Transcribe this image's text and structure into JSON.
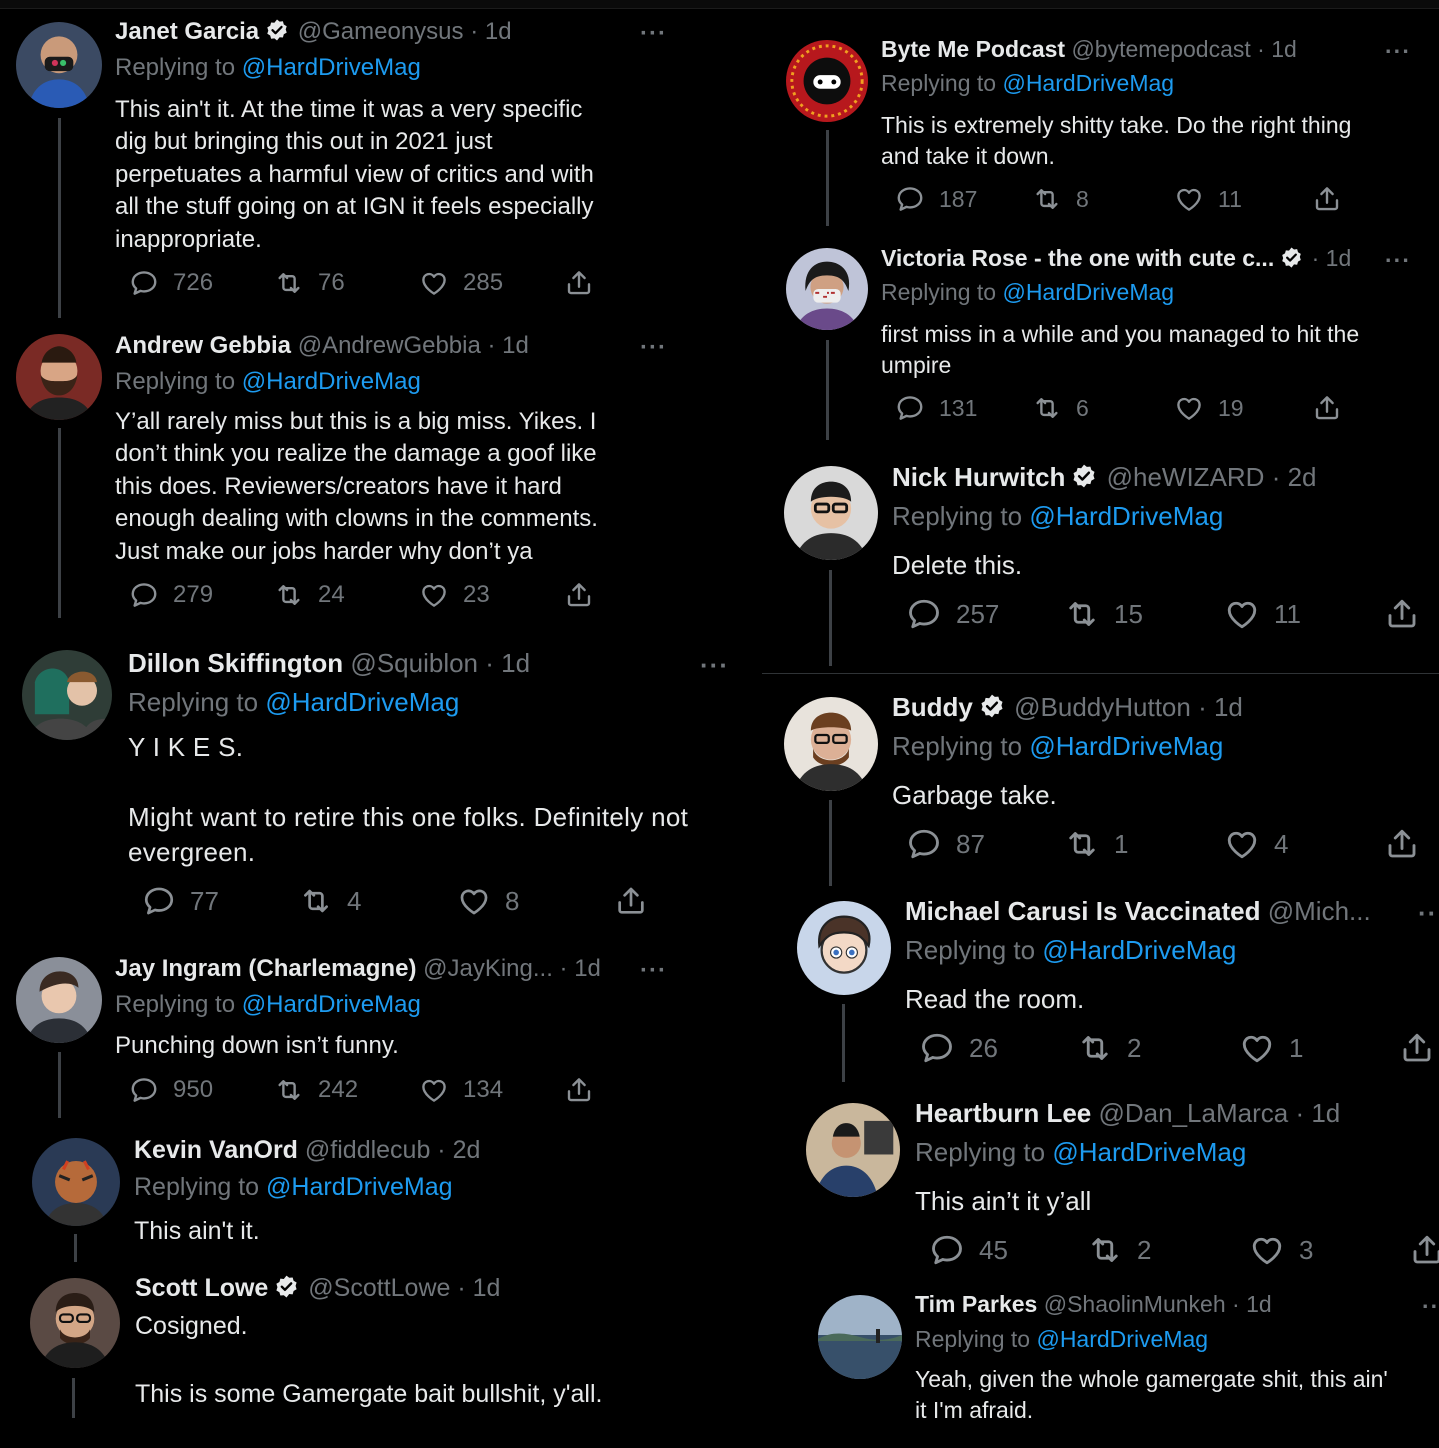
{
  "mention": "@HardDriveMag",
  "replying_prefix": "Replying to ",
  "tweets": [
    {
      "name": "Janet Garcia",
      "handle": "@Gameonysus",
      "time": "1d",
      "text": "This ain't it. At the time it was a very specific\ndig but bringing this out in 2021 just\nperpetuates a harmful view of critics and with\nall the stuff going on at IGN it feels especially\ninappropriate.",
      "replies": "726",
      "retweets": "76",
      "likes": "285",
      "verified": true
    },
    {
      "name": "Andrew Gebbia",
      "handle": "@AndrewGebbia",
      "time": "1d",
      "text": "Y’all rarely miss but this is a big miss. Yikes. I\ndon’t think you realize the damage a goof like\nthis does. Reviewers/creators have it hard\nenough dealing with clowns in the comments.\nJust make our jobs harder why don’t ya",
      "replies": "279",
      "retweets": "24",
      "likes": "23",
      "verified": false
    },
    {
      "name": "Dillon Skiffington",
      "handle": "@Squiblon",
      "time": "1d",
      "text": "Y I K E S.\n\nMight want to retire this one folks. Definitely not\nevergreen.",
      "replies": "77",
      "retweets": "4",
      "likes": "8",
      "verified": false
    },
    {
      "name": "Jay Ingram (Charlemagne)",
      "handle": "@JayKing...",
      "time": "1d",
      "text": "Punching down isn’t funny.",
      "replies": "950",
      "retweets": "242",
      "likes": "134",
      "verified": false
    },
    {
      "name": "Kevin VanOrd",
      "handle": "@fiddlecub",
      "time": "2d",
      "text": "This ain't it.",
      "verified": false
    },
    {
      "name": "Scott Lowe",
      "handle": "@ScottLowe",
      "time": "1d",
      "text": "Cosigned.\n\nThis is some Gamergate bait bullshit, y'all.",
      "verified": true
    },
    {
      "name": "Byte Me Podcast",
      "handle": "@bytemepodcast",
      "time": "1d",
      "text": "This is extremely shitty take. Do the right thing\nand take it down.",
      "replies": "187",
      "retweets": "8",
      "likes": "11",
      "verified": false
    },
    {
      "name": "Victoria Rose - the one with cute c...",
      "handle": "",
      "time": "1d",
      "text": "first miss in a while and you managed to hit the\numpire",
      "replies": "131",
      "retweets": "6",
      "likes": "19",
      "verified": true
    },
    {
      "name": "Nick Hurwitch",
      "handle": "@heWIZARD",
      "time": "2d",
      "text": "Delete this.",
      "replies": "257",
      "retweets": "15",
      "likes": "11",
      "verified": true
    },
    {
      "name": "Buddy",
      "handle": "@BuddyHutton",
      "time": "1d",
      "text": "Garbage take.",
      "replies": "87",
      "retweets": "1",
      "likes": "4",
      "verified": true
    },
    {
      "name": "Michael Carusi Is Vaccinated",
      "handle": "@Mich...",
      "time": "",
      "text": "Read the room.",
      "replies": "26",
      "retweets": "2",
      "likes": "1",
      "verified": false
    },
    {
      "name": "Heartburn Lee",
      "handle": "@Dan_LaMarca",
      "time": "1d",
      "text": "This ain’t it y’all",
      "replies": "45",
      "retweets": "2",
      "likes": "3",
      "verified": false
    },
    {
      "name": "Tim Parkes",
      "handle": "@ShaolinMunkeh",
      "time": "1d",
      "text": "Yeah, given the whole gamergate shit, this ain'\nit I'm afraid.",
      "verified": false
    }
  ],
  "colors": {
    "background": "#000000",
    "text": "#e7e9ea",
    "muted": "#71767b",
    "link": "#1d9bf0"
  }
}
